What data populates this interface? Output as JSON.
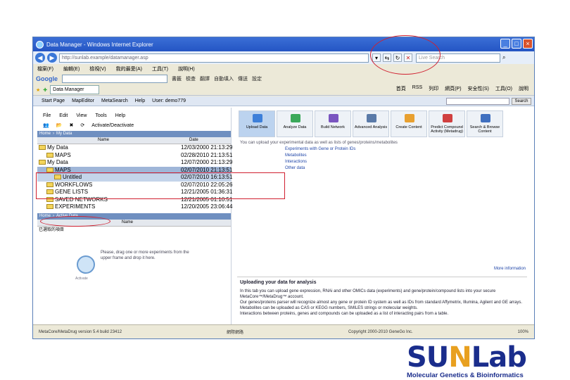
{
  "window": {
    "title": "Data Manager - Windows Internet Explorer",
    "address": "http://sunlab.example/datamanager.asp",
    "live_search_placeholder": "Live Search",
    "tab_label": "Data Manager"
  },
  "menubar": [
    "檔案(F)",
    "編輯(E)",
    "檢視(V)",
    "我的最愛(A)",
    "工具(T)",
    "說明(H)"
  ],
  "googlebar": {
    "logo": "Google",
    "items": [
      "書籤",
      "檢查",
      "翻譯",
      "自動填入",
      "傳送",
      "設定"
    ]
  },
  "cmdbar": [
    "首頁",
    "RSS",
    "列印",
    "網頁(P)",
    "安全性(S)",
    "工具(O)",
    "說明"
  ],
  "app": {
    "menu": [
      "Start Page",
      "MapEditor",
      "MetaSearch",
      "Help",
      "User: demo779"
    ],
    "search_button": "Search",
    "pane_menu": [
      "File",
      "Edit",
      "View",
      "Tools",
      "Help"
    ],
    "pane_tools": "Activate/Deactivate",
    "crumb": [
      "Home",
      "My Data"
    ],
    "tree_headers": {
      "name": "Name",
      "date": "Date"
    },
    "tree": [
      {
        "name": "My Data",
        "date": "12/03/2000 21:13:29",
        "indent": 0,
        "state": "normal"
      },
      {
        "name": "MAPS",
        "date": "02/28/2010 21:13:51",
        "indent": 1,
        "state": "normal"
      },
      {
        "name": "My Data",
        "date": "12/07/2000 21:13:29",
        "indent": 0,
        "state": "normal"
      },
      {
        "name": "MAPS",
        "date": "02/07/2010 21:13:51",
        "indent": 1,
        "state": "sel"
      },
      {
        "name": "Untitled",
        "date": "02/07/2010 16:13:51",
        "indent": 2,
        "state": "sel2"
      },
      {
        "name": "WORKFLOWS",
        "date": "02/07/2010 22:05:26",
        "indent": 1,
        "state": "normal"
      },
      {
        "name": "GENE LISTS",
        "date": "12/21/2005 01:36:31",
        "indent": 1,
        "state": "normal"
      },
      {
        "name": "SAVED NETWORKS",
        "date": "12/21/2005 01:10:51",
        "indent": 1,
        "state": "normal"
      },
      {
        "name": "EXPERIMENTS",
        "date": "12/20/2005 23:06:44",
        "indent": 1,
        "state": "normal"
      }
    ],
    "active_crumb": [
      "Home",
      "Active Data"
    ],
    "active_header": "Name",
    "active_item": "已選取的項目",
    "drop_text": "Please, drag one or more experiments from the upper frame and drop it here.",
    "drop_label": "Activate",
    "tiles": [
      {
        "label": "Upload Data",
        "color": "#3d7fd9"
      },
      {
        "label": "Analyze Data",
        "color": "#3aa85a"
      },
      {
        "label": "Build Network",
        "color": "#7a55c0"
      },
      {
        "label": "Advanced Analysis",
        "color": "#5a7aa8"
      },
      {
        "label": "Create Content",
        "color": "#e8a030"
      },
      {
        "label": "Predict Compound Activity (Metadrug)",
        "color": "#d04040"
      },
      {
        "label": "Search & Browse Content",
        "color": "#4070c0"
      }
    ],
    "desc": "You can upload your experimental data as well as lists of genes/proteins/metabolites",
    "links": [
      "Experiments with Gene or Protein IDs",
      "Metabolites",
      "Interactions",
      "Other data"
    ],
    "more_info": "More information",
    "upload_title": "Uploading your data for analysis",
    "upload_text": [
      "In this tab you can upload gene expression, RNAi and other OMICs data (experiments) and gene/protein/compound lists into your secure MetaCore™/MetaDrug™ account.",
      "Our genes/proteins parser will recognize almost any gene or protein ID system as well as IDs from standard Affymetrix, Illumina, Agilent and GE arrays.",
      "Metabolites can be uploaded as CAS or KEGG numbers, SMILES strings or molecular weights.",
      "Interactions between proteins, genes and compounds can be uploaded as a list of interacting pairs from a table."
    ]
  },
  "status": {
    "left": "MetaCore/MetaDrug version 5.4 build 23412",
    "right": "Copyright 2000-2010 GeneGo Inc.",
    "zone": "網際網路",
    "zoom": "100%"
  },
  "brand": {
    "logo_a": "SU",
    "logo_o": "N",
    "logo_b": "Lab",
    "sub": "Molecular Genetics & Bioinformatics"
  }
}
